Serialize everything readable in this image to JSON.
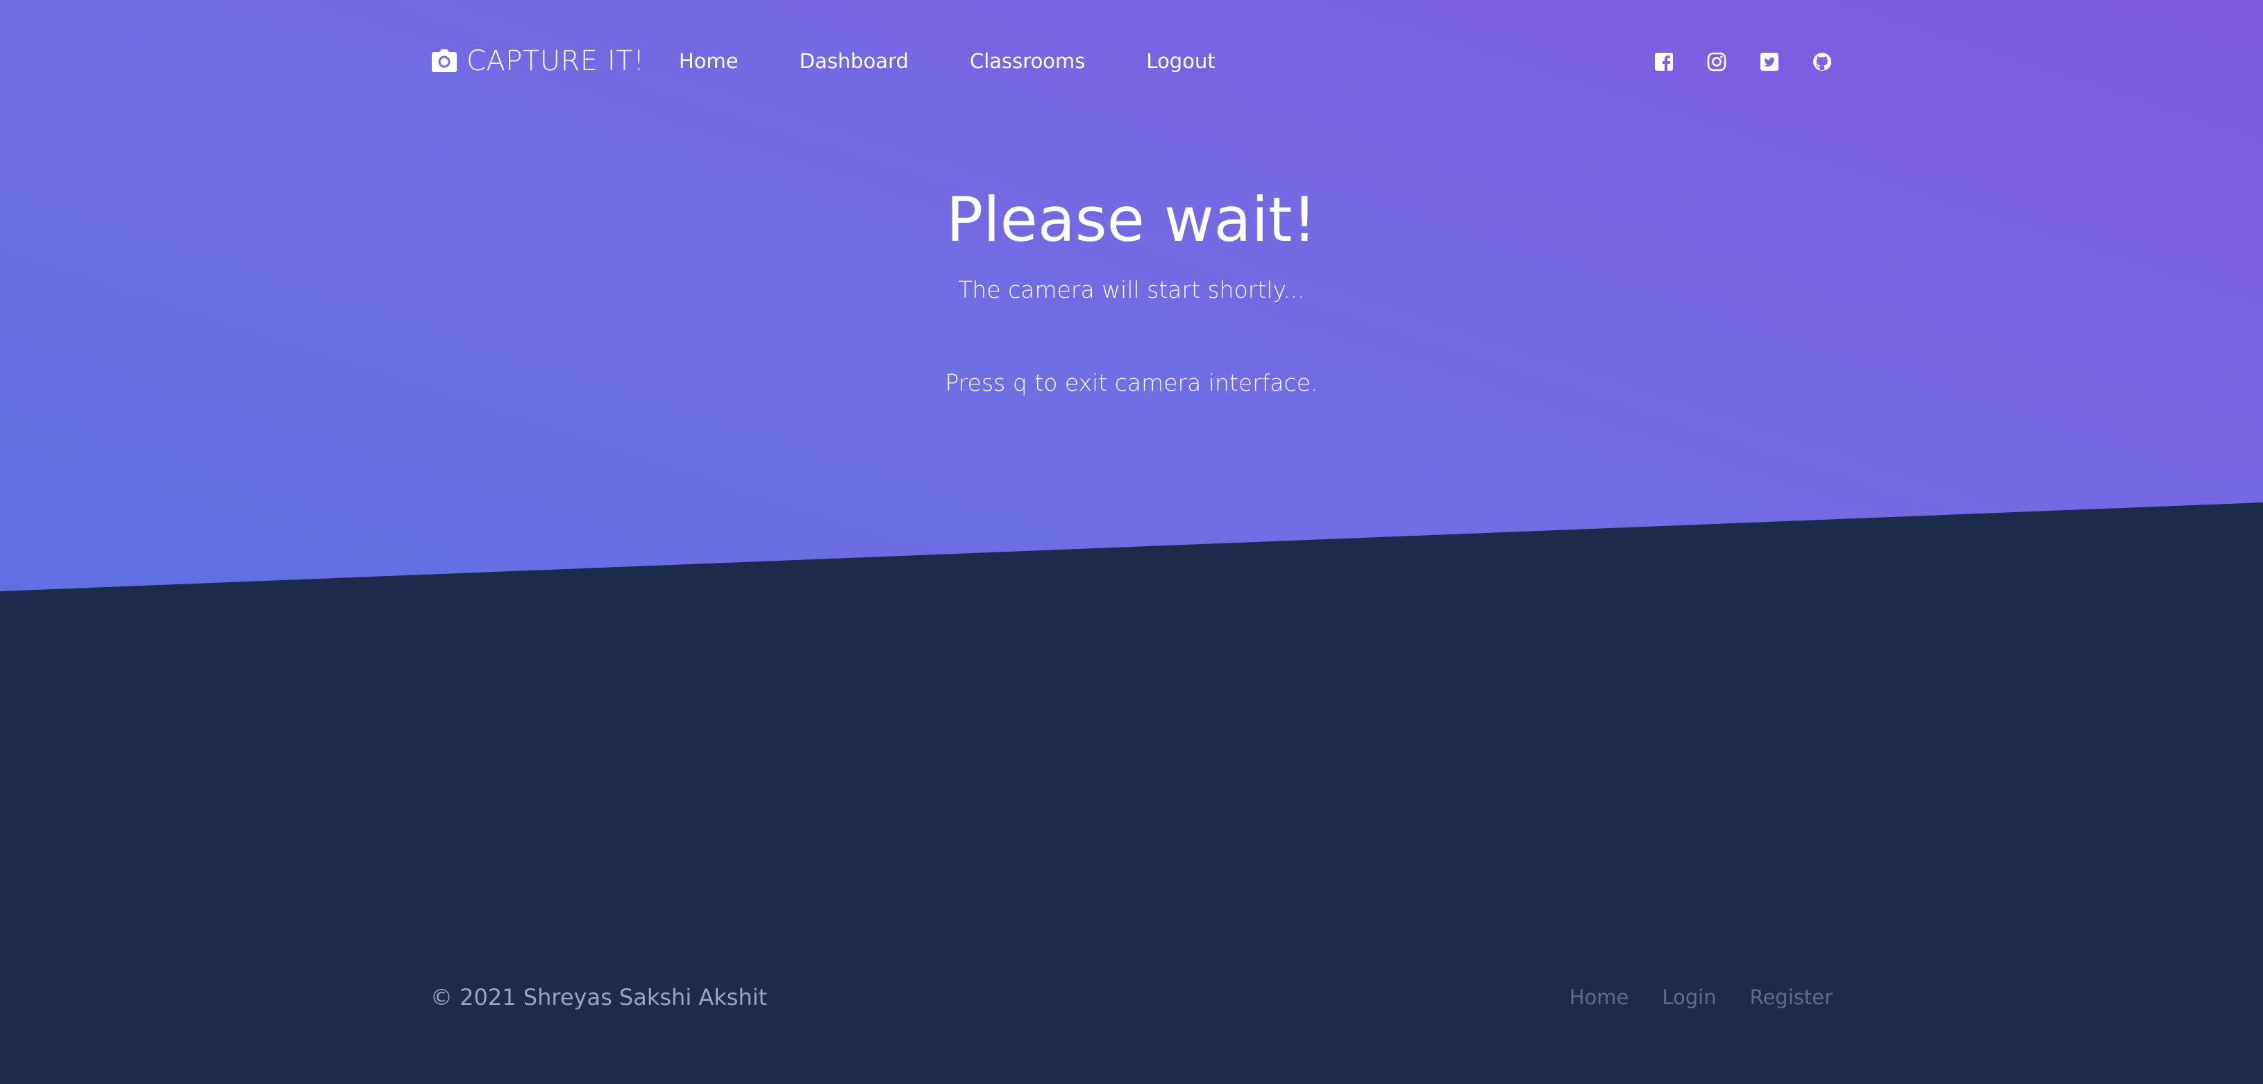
{
  "header": {
    "brand": "CAPTURE IT!",
    "brand_icon": "camera-icon",
    "nav": [
      {
        "label": "Home"
      },
      {
        "label": "Dashboard"
      },
      {
        "label": "Classrooms"
      },
      {
        "label": "Logout"
      }
    ],
    "social": [
      {
        "icon": "facebook-icon"
      },
      {
        "icon": "instagram-icon"
      },
      {
        "icon": "twitter-icon"
      },
      {
        "icon": "github-icon"
      }
    ]
  },
  "hero": {
    "title": "Please wait!",
    "subtitle": "The camera will start shortly...",
    "note": "Press q to exit camera interface."
  },
  "footer": {
    "copyright": "© 2021 Shreyas Sakshi Akshit",
    "links": [
      {
        "label": "Home"
      },
      {
        "label": "Login"
      },
      {
        "label": "Register"
      }
    ]
  },
  "colors": {
    "gradient_start": "#5f6fe2",
    "gradient_end": "#7e5ae0",
    "dark_background": "#1a2b4c",
    "footer_text": "#9aa6bb",
    "footer_link": "#5e6d8a"
  }
}
